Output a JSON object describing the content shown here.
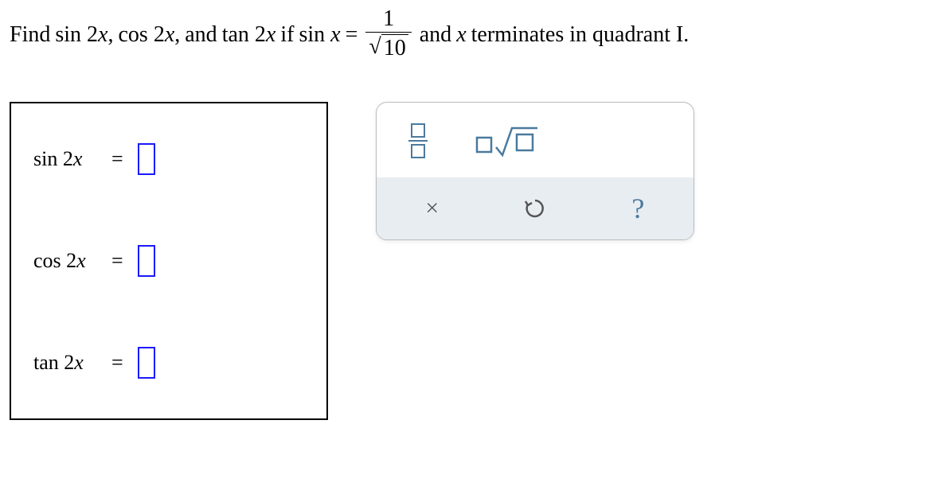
{
  "question": {
    "prefix": "Find",
    "terms": [
      "sin 2x",
      "cos 2x",
      "tan 2x"
    ],
    "connector_and": "and",
    "if_text": "if",
    "given_lhs": "sin x",
    "equals": "=",
    "fraction": {
      "num": "1",
      "den_radicand": "10"
    },
    "suffix_and": "and",
    "suffix_var": "x",
    "suffix_text": "terminates in quadrant I."
  },
  "answers": {
    "rows": [
      {
        "label": "sin 2x",
        "eq": "="
      },
      {
        "label": "cos 2x",
        "eq": "="
      },
      {
        "label": "tan 2x",
        "eq": "="
      }
    ]
  },
  "toolbar": {
    "fraction_tool": "fraction",
    "sqrt_tool": "nth-root",
    "clear": "×",
    "undo": "↺",
    "help": "?"
  }
}
